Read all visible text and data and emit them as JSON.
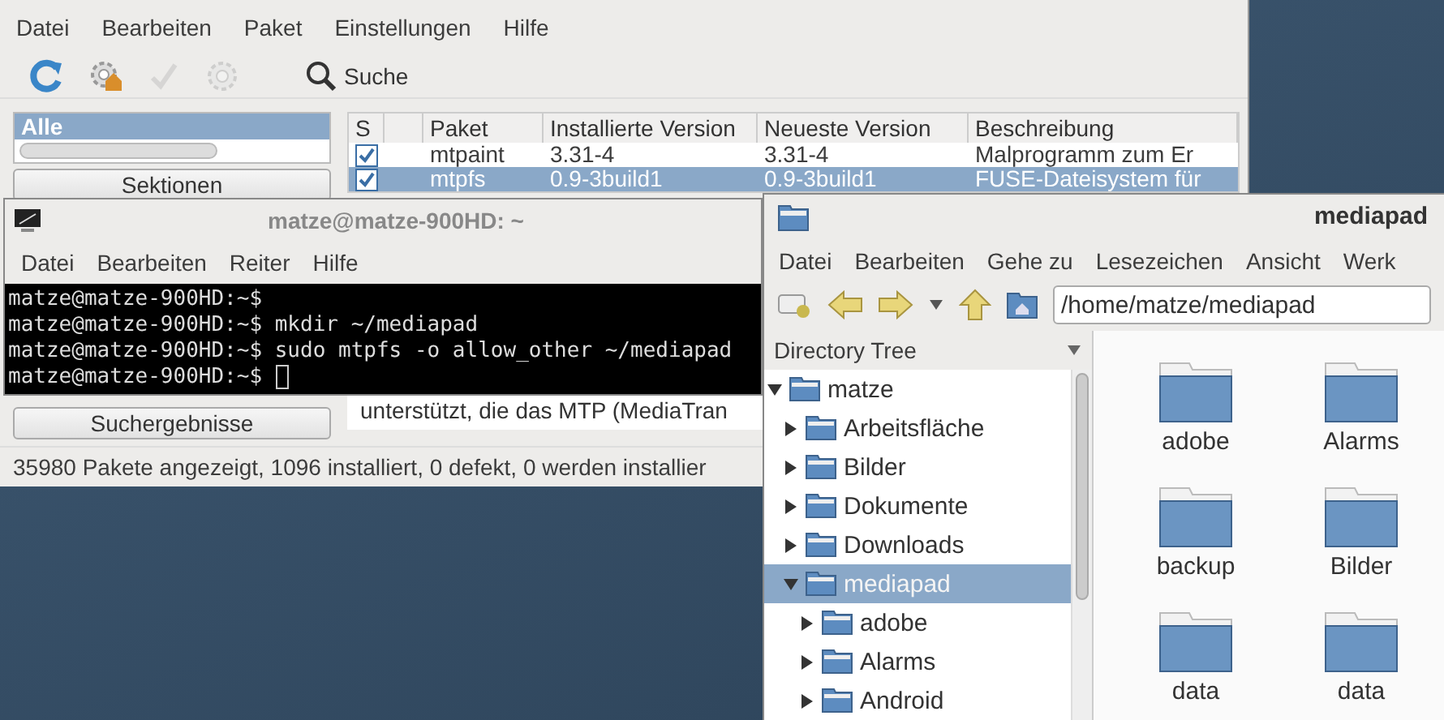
{
  "synaptic": {
    "menu": [
      "Datei",
      "Bearbeiten",
      "Paket",
      "Einstellungen",
      "Hilfe"
    ],
    "toolbar": [
      {
        "kind": "refresh",
        "disabled": false
      },
      {
        "kind": "mark",
        "disabled": false
      },
      {
        "kind": "apply",
        "disabled": true
      },
      {
        "kind": "properties",
        "disabled": true
      }
    ],
    "search_label": "Suche",
    "filters": [
      {
        "label": "Alle",
        "selected": true
      }
    ],
    "buttons": [
      "Sektionen",
      "Suchergebnisse"
    ],
    "table": {
      "columns": [
        "S",
        "Paket",
        "Installierte Version",
        "Neueste Version",
        "Beschreibung"
      ],
      "rows": [
        {
          "checked": true,
          "selected": false,
          "package": "mtpaint",
          "installed": "3.31-4",
          "latest": "3.31-4",
          "description": "Malprogramm zum Er"
        },
        {
          "checked": true,
          "selected": true,
          "package": "mtpfs",
          "installed": "0.9-3build1",
          "latest": "0.9-3build1",
          "description": "FUSE-Dateisystem für"
        }
      ]
    },
    "description": "unterstützt, die das MTP (MediaTran",
    "status_bar": "35980 Pakete angezeigt, 1096 installiert, 0 defekt, 0 werden installier"
  },
  "terminal": {
    "title": "matze@matze-900HD: ~",
    "menu": [
      "Datei",
      "Bearbeiten",
      "Reiter",
      "Hilfe"
    ],
    "lines": [
      "matze@matze-900HD:~$",
      "matze@matze-900HD:~$ mkdir ~/mediapad",
      "matze@matze-900HD:~$ sudo mtpfs -o allow_other ~/mediapad",
      "matze@matze-900HD:~$ "
    ]
  },
  "file_manager": {
    "title": "mediapad",
    "menu": [
      "Datei",
      "Bearbeiten",
      "Gehe zu",
      "Lesezeichen",
      "Ansicht",
      "Werk"
    ],
    "path": "/home/matze/mediapad",
    "pane_title": "Directory Tree",
    "tree": [
      {
        "label": "matze",
        "expanded": true,
        "selected": false,
        "children": [
          {
            "label": "Arbeitsfläche",
            "expanded": false,
            "selected": false
          },
          {
            "label": "Bilder",
            "expanded": false,
            "selected": false
          },
          {
            "label": "Dokumente",
            "expanded": false,
            "selected": false
          },
          {
            "label": "Downloads",
            "expanded": false,
            "selected": false
          },
          {
            "label": "mediapad",
            "expanded": true,
            "selected": true,
            "children": [
              {
                "label": "adobe",
                "expanded": false,
                "selected": false
              },
              {
                "label": "Alarms",
                "expanded": false,
                "selected": false
              },
              {
                "label": "Android",
                "expanded": false,
                "selected": false
              }
            ]
          }
        ]
      }
    ],
    "files": [
      "adobe",
      "Alarms",
      "backup",
      "Bilder",
      "data",
      "data"
    ]
  }
}
